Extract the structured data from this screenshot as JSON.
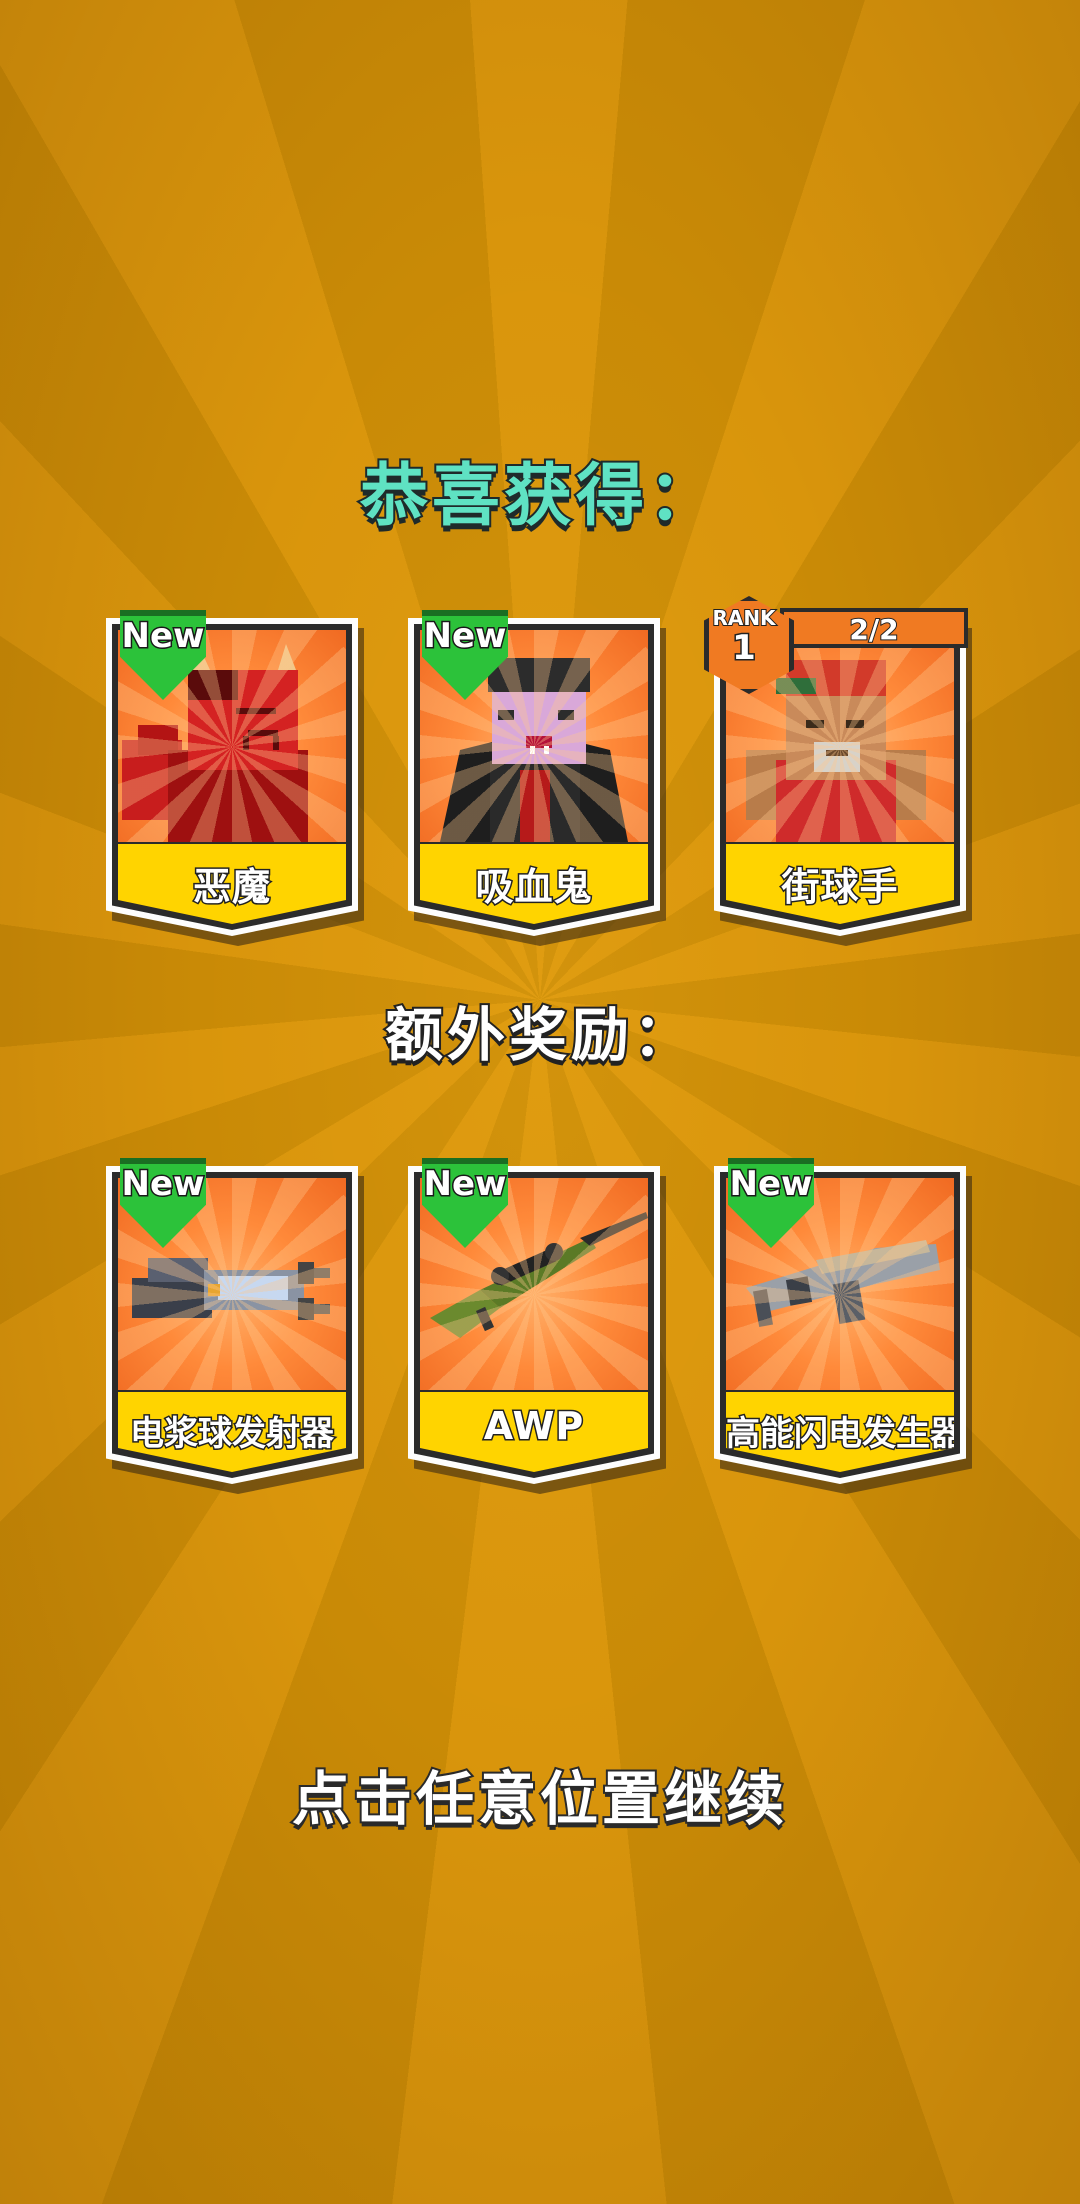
{
  "title": "恭喜获得：",
  "bonus_title": "额外奖励：",
  "continue_hint": "点击任意位置继续",
  "characters": [
    {
      "name": "恶魔",
      "badge": "New",
      "icon": "devil-character-icon"
    },
    {
      "name": "吸血鬼",
      "badge": "New",
      "icon": "vampire-character-icon"
    },
    {
      "name": "街球手",
      "rank_label": "RANK",
      "rank": "1",
      "progress": "2/2",
      "icon": "streetballer-character-icon"
    }
  ],
  "bonus_items": [
    {
      "name": "电浆球发射器",
      "badge": "New",
      "icon": "plasma-launcher-icon"
    },
    {
      "name": "AWP",
      "badge": "New",
      "icon": "sniper-rifle-icon"
    },
    {
      "name": "高能闪电发生器",
      "badge": "New",
      "icon": "lightning-generator-icon"
    }
  ],
  "colors": {
    "background": "#d08f08",
    "title": "#5fe2c3",
    "card_art": "#ff8a3a",
    "card_label": "#ffd400",
    "new_badge": "#2cc23a",
    "rank_badge": "#f07a22"
  }
}
